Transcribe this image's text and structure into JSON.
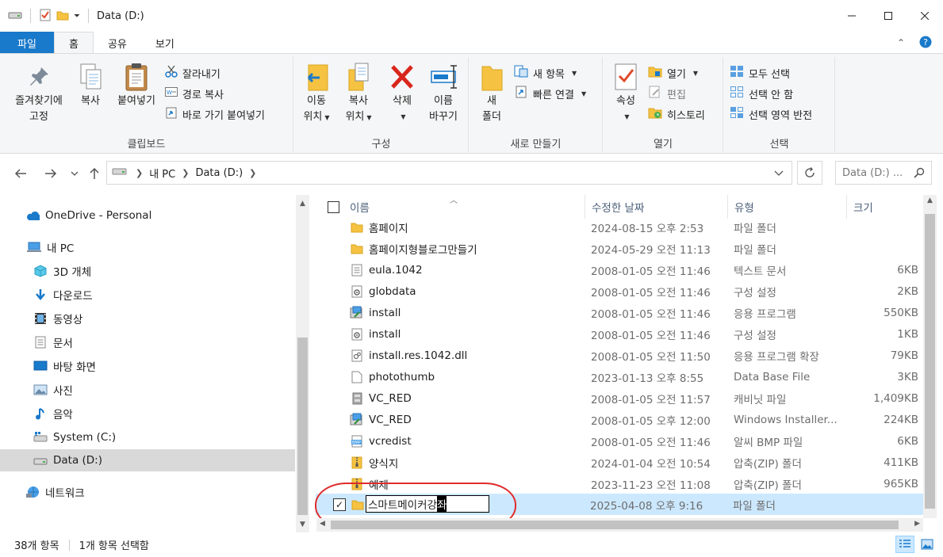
{
  "window": {
    "title": "Data (D:)"
  },
  "tabs": {
    "file": "파일",
    "home": "홈",
    "share": "공유",
    "view": "보기"
  },
  "ribbon": {
    "clipboard": {
      "label": "클립보드",
      "pin_line1": "즐겨찾기에",
      "pin_line2": "고정",
      "copy": "복사",
      "paste": "붙여넣기",
      "cut": "잘라내기",
      "copy_path": "경로 복사",
      "paste_shortcut": "바로 가기 붙여넣기"
    },
    "organize": {
      "label": "구성",
      "move_line1": "이동",
      "move_line2": "위치",
      "copyto_line1": "복사",
      "copyto_line2": "위치",
      "delete": "삭제",
      "rename_line1": "이름",
      "rename_line2": "바꾸기"
    },
    "new": {
      "label": "새로 만들기",
      "folder_line1": "새",
      "folder_line2": "폴더",
      "new_item": "새 항목",
      "easy_access": "빠른 연결"
    },
    "open": {
      "label": "열기",
      "properties": "속성",
      "open": "열기",
      "edit": "편집",
      "history": "히스토리"
    },
    "select": {
      "label": "선택",
      "select_all": "모두 선택",
      "select_none": "선택 안 함",
      "invert": "선택 영역 반전"
    }
  },
  "address": {
    "crumbs": [
      "내 PC",
      "Data (D:)"
    ],
    "search_placeholder": "Data (D:) ..."
  },
  "nav": {
    "items": [
      {
        "label": "OneDrive - Personal"
      },
      {
        "label": "내 PC"
      },
      {
        "label": "3D 개체"
      },
      {
        "label": "다운로드"
      },
      {
        "label": "동영상"
      },
      {
        "label": "문서"
      },
      {
        "label": "바탕 화면"
      },
      {
        "label": "사진"
      },
      {
        "label": "음악"
      },
      {
        "label": "System (C:)"
      },
      {
        "label": "Data (D:)"
      },
      {
        "label": "네트워크"
      }
    ]
  },
  "columns": {
    "name": "이름",
    "date": "수정한 날짜",
    "type": "유형",
    "size": "크기"
  },
  "files": [
    {
      "name": "홈페이지",
      "date": "2024-08-15 오후 2:53",
      "type": "파일 폴더",
      "size": "",
      "icon": "folder-icon"
    },
    {
      "name": "홈페이지형블로그만들기",
      "date": "2024-05-29 오전 11:13",
      "type": "파일 폴더",
      "size": "",
      "icon": "folder-icon"
    },
    {
      "name": "eula.1042",
      "date": "2008-01-05 오전 11:46",
      "type": "텍스트 문서",
      "size": "6KB",
      "icon": "text-file-icon"
    },
    {
      "name": "globdata",
      "date": "2008-01-05 오전 11:46",
      "type": "구성 설정",
      "size": "2KB",
      "icon": "config-file-icon"
    },
    {
      "name": "install",
      "date": "2008-01-05 오전 11:46",
      "type": "응용 프로그램",
      "size": "550KB",
      "icon": "installer-icon"
    },
    {
      "name": "install",
      "date": "2008-01-05 오전 11:46",
      "type": "구성 설정",
      "size": "1KB",
      "icon": "config-file-icon"
    },
    {
      "name": "install.res.1042.dll",
      "date": "2008-01-05 오전 11:50",
      "type": "응용 프로그램 확장",
      "size": "79KB",
      "icon": "dll-file-icon"
    },
    {
      "name": "photothumb",
      "date": "2023-01-13 오후 8:55",
      "type": "Data Base File",
      "size": "3KB",
      "icon": "blank-file-icon"
    },
    {
      "name": "VC_RED",
      "date": "2008-01-05 오전 11:57",
      "type": "캐비닛 파일",
      "size": "1,409KB",
      "icon": "cabinet-file-icon"
    },
    {
      "name": "VC_RED",
      "date": "2008-01-05 오후 12:00",
      "type": "Windows Installer...",
      "size": "224KB",
      "icon": "installer-icon"
    },
    {
      "name": "vcredist",
      "date": "2008-01-05 오전 11:46",
      "type": "알씨 BMP 파일",
      "size": "6KB",
      "icon": "bmp-file-icon"
    },
    {
      "name": "양식지",
      "date": "2024-01-04 오전 10:54",
      "type": "압축(ZIP) 폴더",
      "size": "411KB",
      "icon": "zip-folder-icon"
    },
    {
      "name": "예제",
      "date": "2023-11-23 오전 11:08",
      "type": "압축(ZIP) 폴더",
      "size": "965KB",
      "icon": "zip-folder-icon"
    }
  ],
  "rename_row": {
    "name_prefix": "스마트메이커강",
    "name_selected": "좌",
    "date": "2025-04-08 오후 9:16",
    "type": "파일 폴더"
  },
  "status": {
    "count": "38개 항목",
    "selected": "1개 항목 선택함"
  },
  "colors": {
    "accent": "#1979ca",
    "selection": "#cce8ff",
    "annotation": "#e02b2b"
  }
}
